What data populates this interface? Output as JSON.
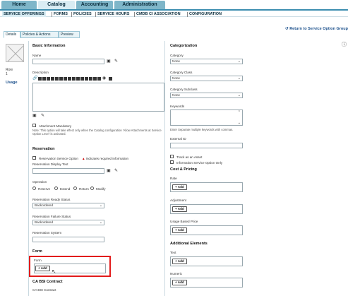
{
  "topnav": {
    "tabs": [
      {
        "label": "Home",
        "active": false
      },
      {
        "label": "Catalog",
        "active": true
      },
      {
        "label": "Accounting",
        "active": false
      },
      {
        "label": "Administration",
        "active": false
      }
    ]
  },
  "subnav": {
    "items": [
      "SERVICE OFFERINGS",
      "FORMS",
      "POLICIES",
      "SERVICE HOURS",
      "CMDB CI ASSOCIATION",
      "CONFIGURATION"
    ]
  },
  "return_link": "Return to Service Option Group",
  "detail_tabs": [
    "Details",
    "Policies & Actions",
    "Preview"
  ],
  "left_panel": {
    "row_label": "Row",
    "row_value": "1",
    "usage_link": "Usage"
  },
  "basic": {
    "title": "Basic Information",
    "name_label": "Name",
    "description_label": "Description",
    "attachment_label": "Attachment Mandatory",
    "attachment_note": "Note: This option will take effect only when the Catalog configuration 'Allow Attachments at Service Option Level' is activated."
  },
  "reservation": {
    "title": "Reservation",
    "reservation_option": "Reservation Service Option",
    "required_note": "indicates required information",
    "display_text_label": "Reservation Display Text",
    "operation_label": "Operation",
    "operations": [
      "Reserve",
      "Extend",
      "Return",
      "Modify"
    ],
    "ready_status_label": "Reservation Ready Status",
    "ready_status_value": "Backordered",
    "failure_status_label": "Reservation Failure Status",
    "failure_status_value": "Backordered",
    "system_label": "Reservation System"
  },
  "form": {
    "title": "Form",
    "form_label": "Form",
    "add_label": "+ Add"
  },
  "ca_bsi": {
    "title": "CA BSI Contract",
    "field_label": "CA BSI Contract"
  },
  "categorization": {
    "title": "Categorization",
    "category_label": "Category",
    "category_value": "None",
    "category_class_label": "Category Class",
    "category_class_value": "None",
    "category_subclass_label": "Category Subclass",
    "category_subclass_value": "None",
    "keywords_label": "Keywords",
    "keywords_note": "Enter Separate multiple keywords with commas.",
    "external_id_label": "External ID",
    "track_asset_label": "Track as an Asset",
    "info_only_label": "Information Service Option Only"
  },
  "cost": {
    "title": "Cost & Pricing",
    "rate_label": "Rate",
    "adjustment_label": "Adjustment",
    "usage_price_label": "Usage Based Price",
    "add_label": "+ Add"
  },
  "additional": {
    "title": "Additional Elements",
    "text_label": "Text",
    "numeric_label": "Numeric",
    "add_label": "+ Add"
  }
}
